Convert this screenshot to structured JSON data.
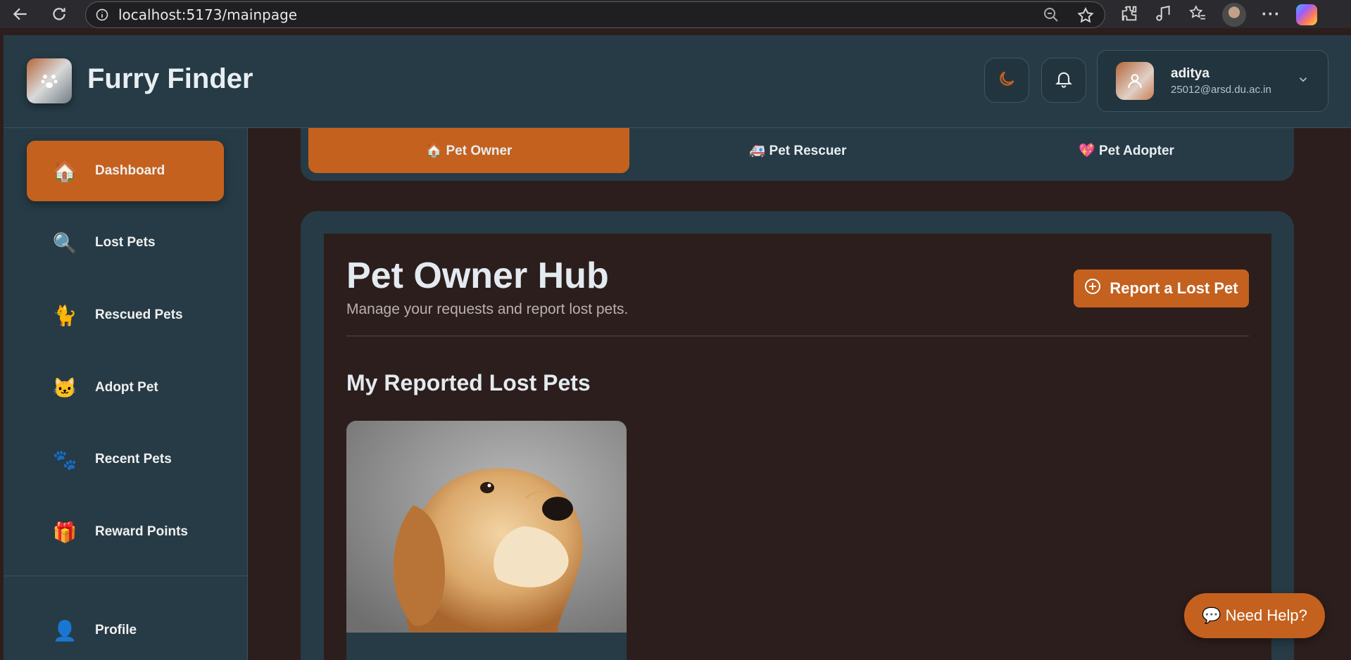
{
  "browser": {
    "url": "localhost:5173/mainpage"
  },
  "header": {
    "app_title": "Furry Finder",
    "user": {
      "name": "aditya",
      "email": "25012@arsd.du.ac.in"
    }
  },
  "sidebar": {
    "items": [
      {
        "icon": "🏠",
        "label": "Dashboard",
        "active": true
      },
      {
        "icon": "🔍",
        "label": "Lost Pets"
      },
      {
        "icon": "🐈",
        "label": "Rescued Pets"
      },
      {
        "icon": "🐱",
        "label": "Adopt Pet"
      },
      {
        "icon": "🐾",
        "label": "Recent Pets"
      },
      {
        "icon": "🎁",
        "label": "Reward Points"
      }
    ],
    "profile": {
      "icon": "👤",
      "label": "Profile"
    }
  },
  "tabs": [
    {
      "label": "🏠 Pet Owner",
      "active": true
    },
    {
      "label": "🚑 Pet Rescuer"
    },
    {
      "label": "💖 Pet Adopter"
    }
  ],
  "hub": {
    "title": "Pet Owner Hub",
    "subtitle": "Manage your requests and report lost pets.",
    "report_button": "Report a Lost Pet",
    "section_title": "My Reported Lost Pets"
  },
  "help_button": "💬 Need Help?",
  "colors": {
    "accent": "#c4611f",
    "panel": "#263b45",
    "background": "#2c1e1c"
  }
}
